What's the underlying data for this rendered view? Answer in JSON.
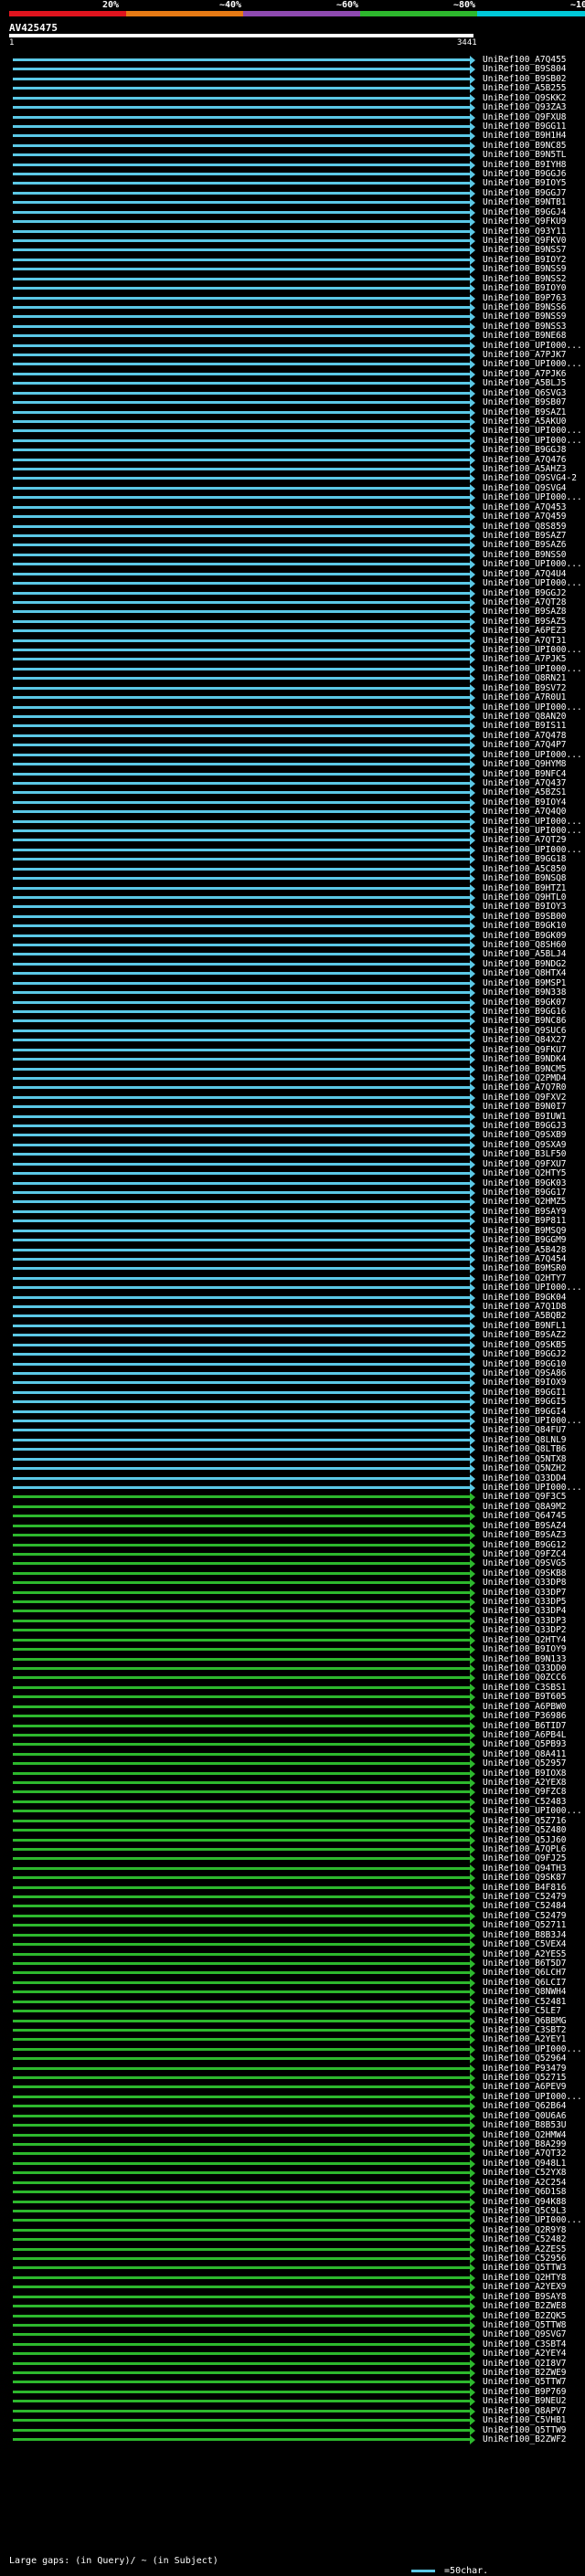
{
  "scale_labels": [
    "20%",
    "~40%",
    "~60%",
    "~80%",
    "~100%"
  ],
  "scale_colors": [
    "#e0141e",
    "#e67a14",
    "#8e4ab0",
    "#2db82d",
    "#00c8d8"
  ],
  "query": {
    "id": "AV425475",
    "start": "1",
    "end": "3441"
  },
  "footer": {
    "large_gaps": "Large gaps:",
    "in_query": "(in Query)/",
    "in_subject": "~ (in Subject)",
    "scale": "=50char."
  },
  "hits": [
    {
      "label": "UniRef100_A7Q455",
      "color": "#5bc8e6"
    },
    {
      "label": "UniRef100_B9S804",
      "color": "#5bc8e6"
    },
    {
      "label": "UniRef100_B9SB02",
      "color": "#5bc8e6"
    },
    {
      "label": "UniRef100_A5B255",
      "color": "#5bc8e6"
    },
    {
      "label": "UniRef100_Q9SKK2",
      "color": "#5bc8e6"
    },
    {
      "label": "UniRef100_Q93ZA3",
      "color": "#5bc8e6"
    },
    {
      "label": "UniRef100_Q9FXU8",
      "color": "#5bc8e6"
    },
    {
      "label": "UniRef100_B9GG11",
      "color": "#5bc8e6"
    },
    {
      "label": "UniRef100_B9H1H4",
      "color": "#5bc8e6"
    },
    {
      "label": "UniRef100_B9NC85",
      "color": "#5bc8e6"
    },
    {
      "label": "UniRef100_B9N5TL",
      "color": "#5bc8e6"
    },
    {
      "label": "UniRef100_B9IYH8",
      "color": "#5bc8e6"
    },
    {
      "label": "UniRef100_B9GGJ6",
      "color": "#5bc8e6"
    },
    {
      "label": "UniRef100_B9IOY5",
      "color": "#5bc8e6"
    },
    {
      "label": "UniRef100_B9GGJ7",
      "color": "#5bc8e6"
    },
    {
      "label": "UniRef100_B9NTB1",
      "color": "#5bc8e6"
    },
    {
      "label": "UniRef100_B9GGJ4",
      "color": "#5bc8e6"
    },
    {
      "label": "UniRef100_Q9FKU9",
      "color": "#5bc8e6"
    },
    {
      "label": "UniRef100_Q93Y11",
      "color": "#5bc8e6"
    },
    {
      "label": "UniRef100_Q9FKV0",
      "color": "#5bc8e6"
    },
    {
      "label": "UniRef100_B9NSS7",
      "color": "#5bc8e6"
    },
    {
      "label": "UniRef100_B9IOY2",
      "color": "#5bc8e6"
    },
    {
      "label": "UniRef100_B9NSS9",
      "color": "#5bc8e6"
    },
    {
      "label": "UniRef100_B9NSS2",
      "color": "#5bc8e6"
    },
    {
      "label": "UniRef100_B9IOY0",
      "color": "#5bc8e6"
    },
    {
      "label": "UniRef100_B9P763",
      "color": "#5bc8e6"
    },
    {
      "label": "UniRef100_B9NSS6",
      "color": "#5bc8e6"
    },
    {
      "label": "UniRef100_B9NSS9",
      "color": "#5bc8e6"
    },
    {
      "label": "UniRef100_B9NSS3",
      "color": "#5bc8e6"
    },
    {
      "label": "UniRef100_B9NE68",
      "color": "#5bc8e6"
    },
    {
      "label": "UniRef100_UPI000...",
      "color": "#5bc8e6"
    },
    {
      "label": "UniRef100_A7PJK7",
      "color": "#5bc8e6"
    },
    {
      "label": "UniRef100_UPI000...",
      "color": "#5bc8e6"
    },
    {
      "label": "UniRef100_A7PJK6",
      "color": "#5bc8e6"
    },
    {
      "label": "UniRef100_A5BLJ5",
      "color": "#5bc8e6"
    },
    {
      "label": "UniRef100_Q6SVG3",
      "color": "#5bc8e6"
    },
    {
      "label": "UniRef100_B9SB07",
      "color": "#5bc8e6"
    },
    {
      "label": "UniRef100_B9SAZ1",
      "color": "#5bc8e6"
    },
    {
      "label": "UniRef100_A5AKU0",
      "color": "#5bc8e6"
    },
    {
      "label": "UniRef100_UPI000...",
      "color": "#5bc8e6"
    },
    {
      "label": "UniRef100_UPI000...",
      "color": "#5bc8e6"
    },
    {
      "label": "UniRef100_B9GGJ8",
      "color": "#5bc8e6"
    },
    {
      "label": "UniRef100_A7Q476",
      "color": "#5bc8e6"
    },
    {
      "label": "UniRef100_A5AHZ3",
      "color": "#5bc8e6"
    },
    {
      "label": "UniRef100_Q9SVG4-2",
      "color": "#5bc8e6"
    },
    {
      "label": "UniRef100_Q9SVG4",
      "color": "#5bc8e6"
    },
    {
      "label": "UniRef100_UPI000...",
      "color": "#5bc8e6"
    },
    {
      "label": "UniRef100_A7Q453",
      "color": "#5bc8e6"
    },
    {
      "label": "UniRef100_A7Q459",
      "color": "#5bc8e6"
    },
    {
      "label": "UniRef100_Q8S859",
      "color": "#5bc8e6"
    },
    {
      "label": "UniRef100_B9SAZ7",
      "color": "#5bc8e6"
    },
    {
      "label": "UniRef100_B9SAZ6",
      "color": "#5bc8e6"
    },
    {
      "label": "UniRef100_B9NSS0",
      "color": "#5bc8e6"
    },
    {
      "label": "UniRef100_UPI000...",
      "color": "#5bc8e6"
    },
    {
      "label": "UniRef100_A7Q4U4",
      "color": "#5bc8e6"
    },
    {
      "label": "UniRef100_UPI000...",
      "color": "#5bc8e6"
    },
    {
      "label": "UniRef100_B9GGJ2",
      "color": "#5bc8e6"
    },
    {
      "label": "UniRef100_A7QT28",
      "color": "#5bc8e6"
    },
    {
      "label": "UniRef100_B9SAZ8",
      "color": "#5bc8e6"
    },
    {
      "label": "UniRef100_B9SAZ5",
      "color": "#5bc8e6"
    },
    {
      "label": "UniRef100_A6PEZ3",
      "color": "#5bc8e6"
    },
    {
      "label": "UniRef100_A7QT31",
      "color": "#5bc8e6"
    },
    {
      "label": "UniRef100_UPI000...",
      "color": "#5bc8e6"
    },
    {
      "label": "UniRef100_A7PJK5",
      "color": "#5bc8e6"
    },
    {
      "label": "UniRef100_UPI000...",
      "color": "#5bc8e6"
    },
    {
      "label": "UniRef100_Q8RN21",
      "color": "#5bc8e6"
    },
    {
      "label": "UniRef100_B9SV72",
      "color": "#5bc8e6"
    },
    {
      "label": "UniRef100_A7R0U1",
      "color": "#5bc8e6"
    },
    {
      "label": "UniRef100_UPI000...",
      "color": "#5bc8e6"
    },
    {
      "label": "UniRef100_Q8AN20",
      "color": "#5bc8e6"
    },
    {
      "label": "UniRef100_B9IS11",
      "color": "#5bc8e6"
    },
    {
      "label": "UniRef100_A7Q478",
      "color": "#5bc8e6"
    },
    {
      "label": "UniRef100_A7Q4P7",
      "color": "#5bc8e6"
    },
    {
      "label": "UniRef100_UPI000...",
      "color": "#5bc8e6"
    },
    {
      "label": "UniRef100_Q9HYM8",
      "color": "#5bc8e6"
    },
    {
      "label": "UniRef100_B9NFC4",
      "color": "#5bc8e6"
    },
    {
      "label": "UniRef100_A7Q437",
      "color": "#5bc8e6"
    },
    {
      "label": "UniRef100_A5BZS1",
      "color": "#5bc8e6"
    },
    {
      "label": "UniRef100_B9IOY4",
      "color": "#5bc8e6"
    },
    {
      "label": "UniRef100_A7Q4Q0",
      "color": "#5bc8e6"
    },
    {
      "label": "UniRef100_UPI000...",
      "color": "#5bc8e6"
    },
    {
      "label": "UniRef100_UPI000...",
      "color": "#5bc8e6"
    },
    {
      "label": "UniRef100_A7QT29",
      "color": "#5bc8e6"
    },
    {
      "label": "UniRef100_UPI000...",
      "color": "#5bc8e6"
    },
    {
      "label": "UniRef100_B9GG18",
      "color": "#5bc8e6"
    },
    {
      "label": "UniRef100_A5C850",
      "color": "#5bc8e6"
    },
    {
      "label": "UniRef100_B9NSQ8",
      "color": "#5bc8e6"
    },
    {
      "label": "UniRef100_B9HTZ1",
      "color": "#5bc8e6"
    },
    {
      "label": "UniRef100_Q9HTL0",
      "color": "#5bc8e6"
    },
    {
      "label": "UniRef100_B9IOY3",
      "color": "#5bc8e6"
    },
    {
      "label": "UniRef100_B9SB00",
      "color": "#5bc8e6"
    },
    {
      "label": "UniRef100_B9GK10",
      "color": "#5bc8e6"
    },
    {
      "label": "UniRef100_B9GK09",
      "color": "#5bc8e6"
    },
    {
      "label": "UniRef100_Q8SH60",
      "color": "#5bc8e6"
    },
    {
      "label": "UniRef100_A5BLJ4",
      "color": "#5bc8e6"
    },
    {
      "label": "UniRef100_B9NDG2",
      "color": "#5bc8e6"
    },
    {
      "label": "UniRef100_Q8HTX4",
      "color": "#5bc8e6"
    },
    {
      "label": "UniRef100_B9MSP1",
      "color": "#5bc8e6"
    },
    {
      "label": "UniRef100_B9N338",
      "color": "#5bc8e6"
    },
    {
      "label": "UniRef100_B9GK07",
      "color": "#5bc8e6"
    },
    {
      "label": "UniRef100_B9GG16",
      "color": "#5bc8e6"
    },
    {
      "label": "UniRef100_B9NC86",
      "color": "#5bc8e6"
    },
    {
      "label": "UniRef100_Q9SUC6",
      "color": "#5bc8e6"
    },
    {
      "label": "UniRef100_Q84X27",
      "color": "#5bc8e6"
    },
    {
      "label": "UniRef100_Q9FKU7",
      "color": "#5bc8e6"
    },
    {
      "label": "UniRef100_B9NDK4",
      "color": "#5bc8e6"
    },
    {
      "label": "UniRef100_B9NCM5",
      "color": "#5bc8e6"
    },
    {
      "label": "UniRef100_Q2PMD4",
      "color": "#5bc8e6"
    },
    {
      "label": "UniRef100_A7Q7R0",
      "color": "#5bc8e6"
    },
    {
      "label": "UniRef100_Q9FXV2",
      "color": "#5bc8e6"
    },
    {
      "label": "UniRef100_B9N0I7",
      "color": "#5bc8e6"
    },
    {
      "label": "UniRef100_B9IUW1",
      "color": "#5bc8e6"
    },
    {
      "label": "UniRef100_B9GGJ3",
      "color": "#5bc8e6"
    },
    {
      "label": "UniRef100_Q9SXB9",
      "color": "#5bc8e6"
    },
    {
      "label": "UniRef100_Q9SXA9",
      "color": "#5bc8e6"
    },
    {
      "label": "UniRef100_B3LF50",
      "color": "#5bc8e6"
    },
    {
      "label": "UniRef100_Q9FXU7",
      "color": "#5bc8e6"
    },
    {
      "label": "UniRef100_Q2HTY5",
      "color": "#5bc8e6"
    },
    {
      "label": "UniRef100_B9GK03",
      "color": "#5bc8e6"
    },
    {
      "label": "UniRef100_B9GG17",
      "color": "#5bc8e6"
    },
    {
      "label": "UniRef100_Q2HMZ5",
      "color": "#5bc8e6"
    },
    {
      "label": "UniRef100_B9SAY9",
      "color": "#5bc8e6"
    },
    {
      "label": "UniRef100_B9P811",
      "color": "#5bc8e6"
    },
    {
      "label": "UniRef100_B9MSQ9",
      "color": "#5bc8e6"
    },
    {
      "label": "UniRef100_B9GGM9",
      "color": "#5bc8e6"
    },
    {
      "label": "UniRef100_A5B428",
      "color": "#5bc8e6"
    },
    {
      "label": "UniRef100_A7Q454",
      "color": "#5bc8e6"
    },
    {
      "label": "UniRef100_B9MSR0",
      "color": "#5bc8e6"
    },
    {
      "label": "UniRef100_Q2HTY7",
      "color": "#5bc8e6"
    },
    {
      "label": "UniRef100_UPI000...",
      "color": "#5bc8e6"
    },
    {
      "label": "UniRef100_B9GK04",
      "color": "#5bc8e6"
    },
    {
      "label": "UniRef100_A7Q1D8",
      "color": "#5bc8e6"
    },
    {
      "label": "UniRef100_A5BQB2",
      "color": "#5bc8e6"
    },
    {
      "label": "UniRef100_B9NFL1",
      "color": "#5bc8e6"
    },
    {
      "label": "UniRef100_B9SAZ2",
      "color": "#5bc8e6"
    },
    {
      "label": "UniRef100_Q9SKB5",
      "color": "#5bc8e6"
    },
    {
      "label": "UniRef100_B9GGJ2",
      "color": "#5bc8e6"
    },
    {
      "label": "UniRef100_B9GG10",
      "color": "#5bc8e6"
    },
    {
      "label": "UniRef100_Q9SA86",
      "color": "#5bc8e6"
    },
    {
      "label": "UniRef100_B9IOX9",
      "color": "#5bc8e6"
    },
    {
      "label": "UniRef100_B9GGI1",
      "color": "#5bc8e6"
    },
    {
      "label": "UniRef100_B9GGI5",
      "color": "#5bc8e6"
    },
    {
      "label": "UniRef100_B9GGI4",
      "color": "#5bc8e6"
    },
    {
      "label": "UniRef100_UPI000...",
      "color": "#5bc8e6"
    },
    {
      "label": "UniRef100_Q84FU7",
      "color": "#5bc8e6"
    },
    {
      "label": "UniRef100_Q8LNL9",
      "color": "#5bc8e6"
    },
    {
      "label": "UniRef100_Q8LTB6",
      "color": "#5bc8e6"
    },
    {
      "label": "UniRef100_Q5NTX8",
      "color": "#5bc8e6"
    },
    {
      "label": "UniRef100_Q5NZH2",
      "color": "#5bc8e6"
    },
    {
      "label": "UniRef100_Q33DD4",
      "color": "#5bc8e6"
    },
    {
      "label": "UniRef100_UPI000...",
      "color": "#5bc8e6"
    },
    {
      "label": "UniRef100_Q9F3C5",
      "color": "#2db82d"
    },
    {
      "label": "UniRef100_Q8A9M2",
      "color": "#2db82d"
    },
    {
      "label": "UniRef100_Q64745",
      "color": "#2db82d"
    },
    {
      "label": "UniRef100_B9SAZ4",
      "color": "#2db82d"
    },
    {
      "label": "UniRef100_B9SAZ3",
      "color": "#2db82d"
    },
    {
      "label": "UniRef100_B9GG12",
      "color": "#2db82d"
    },
    {
      "label": "UniRef100_Q9FZC4",
      "color": "#2db82d"
    },
    {
      "label": "UniRef100_Q9SVG5",
      "color": "#2db82d"
    },
    {
      "label": "UniRef100_Q9SKB8",
      "color": "#2db82d"
    },
    {
      "label": "UniRef100_Q33DP8",
      "color": "#2db82d"
    },
    {
      "label": "UniRef100_Q33DP7",
      "color": "#2db82d"
    },
    {
      "label": "UniRef100_Q33DP5",
      "color": "#2db82d"
    },
    {
      "label": "UniRef100_Q33DP4",
      "color": "#2db82d"
    },
    {
      "label": "UniRef100_Q33DP3",
      "color": "#2db82d"
    },
    {
      "label": "UniRef100_Q33DP2",
      "color": "#2db82d"
    },
    {
      "label": "UniRef100_Q2HTY4",
      "color": "#2db82d"
    },
    {
      "label": "UniRef100_B9IOY9",
      "color": "#2db82d"
    },
    {
      "label": "UniRef100_B9N133",
      "color": "#2db82d"
    },
    {
      "label": "UniRef100_Q33DD0",
      "color": "#2db82d"
    },
    {
      "label": "UniRef100_Q0ZCC6",
      "color": "#2db82d"
    },
    {
      "label": "UniRef100_C3SBS1",
      "color": "#2db82d"
    },
    {
      "label": "UniRef100_B9T605",
      "color": "#2db82d"
    },
    {
      "label": "UniRef100_A6PBW0",
      "color": "#2db82d"
    },
    {
      "label": "UniRef100_P36986",
      "color": "#2db82d"
    },
    {
      "label": "UniRef100_B6TID7",
      "color": "#2db82d"
    },
    {
      "label": "UniRef100_A6PB4L",
      "color": "#2db82d"
    },
    {
      "label": "UniRef100_Q5PB93",
      "color": "#2db82d"
    },
    {
      "label": "UniRef100_Q8A411",
      "color": "#2db82d"
    },
    {
      "label": "UniRef100_Q52957",
      "color": "#2db82d"
    },
    {
      "label": "UniRef100_B9IOX8",
      "color": "#2db82d"
    },
    {
      "label": "UniRef100_A2YEX8",
      "color": "#2db82d"
    },
    {
      "label": "UniRef100_Q9FZC8",
      "color": "#2db82d"
    },
    {
      "label": "UniRef100_C52483",
      "color": "#2db82d"
    },
    {
      "label": "UniRef100_UPI000...",
      "color": "#2db82d"
    },
    {
      "label": "UniRef100_Q5Z716",
      "color": "#2db82d"
    },
    {
      "label": "UniRef100_Q5Z480",
      "color": "#2db82d"
    },
    {
      "label": "UniRef100_Q5JJ60",
      "color": "#2db82d"
    },
    {
      "label": "UniRef100_A7QPL6",
      "color": "#2db82d"
    },
    {
      "label": "UniRef100_Q9FJ25",
      "color": "#2db82d"
    },
    {
      "label": "UniRef100_Q94TH3",
      "color": "#2db82d"
    },
    {
      "label": "UniRef100_Q9SK87",
      "color": "#2db82d"
    },
    {
      "label": "UniRef100_B4F816",
      "color": "#2db82d"
    },
    {
      "label": "UniRef100_C52479",
      "color": "#2db82d"
    },
    {
      "label": "UniRef100_C52484",
      "color": "#2db82d"
    },
    {
      "label": "UniRef100_C52479",
      "color": "#2db82d"
    },
    {
      "label": "UniRef100_Q52711",
      "color": "#2db82d"
    },
    {
      "label": "UniRef100_B8B3J4",
      "color": "#2db82d"
    },
    {
      "label": "UniRef100_C5VEX4",
      "color": "#2db82d"
    },
    {
      "label": "UniRef100_A2YES5",
      "color": "#2db82d"
    },
    {
      "label": "UniRef100_B6T5D7",
      "color": "#2db82d"
    },
    {
      "label": "UniRef100_Q6LCH7",
      "color": "#2db82d"
    },
    {
      "label": "UniRef100_Q6LCI7",
      "color": "#2db82d"
    },
    {
      "label": "UniRef100_Q8NWH4",
      "color": "#2db82d"
    },
    {
      "label": "UniRef100_C52481",
      "color": "#2db82d"
    },
    {
      "label": "UniRef100_C5LE7",
      "color": "#2db82d"
    },
    {
      "label": "UniRef100_Q6BBMG",
      "color": "#2db82d"
    },
    {
      "label": "UniRef100_C3SBT2",
      "color": "#2db82d"
    },
    {
      "label": "UniRef100_A2YEY1",
      "color": "#2db82d"
    },
    {
      "label": "UniRef100_UPI000...",
      "color": "#2db82d"
    },
    {
      "label": "UniRef100_Q52964",
      "color": "#2db82d"
    },
    {
      "label": "UniRef100_P93479",
      "color": "#2db82d"
    },
    {
      "label": "UniRef100_Q52715",
      "color": "#2db82d"
    },
    {
      "label": "UniRef100_A6PEV9",
      "color": "#2db82d"
    },
    {
      "label": "UniRef100_UPI000...",
      "color": "#2db82d"
    },
    {
      "label": "UniRef100_Q62B64",
      "color": "#2db82d"
    },
    {
      "label": "UniRef100_Q0U6A6",
      "color": "#2db82d"
    },
    {
      "label": "UniRef100_B8B53U",
      "color": "#2db82d"
    },
    {
      "label": "UniRef100_Q2HMW4",
      "color": "#2db82d"
    },
    {
      "label": "UniRef100_B8A299",
      "color": "#2db82d"
    },
    {
      "label": "UniRef100_A7QT32",
      "color": "#2db82d"
    },
    {
      "label": "UniRef100_Q948L1",
      "color": "#2db82d"
    },
    {
      "label": "UniRef100_C52YX8",
      "color": "#2db82d"
    },
    {
      "label": "UniRef100_A2C254",
      "color": "#2db82d"
    },
    {
      "label": "UniRef100_Q6D1S8",
      "color": "#2db82d"
    },
    {
      "label": "UniRef100_Q94K88",
      "color": "#2db82d"
    },
    {
      "label": "UniRef100_Q5C9L3",
      "color": "#2db82d"
    },
    {
      "label": "UniRef100_UPI000...",
      "color": "#2db82d"
    },
    {
      "label": "UniRef100_Q2R9Y8",
      "color": "#2db82d"
    },
    {
      "label": "UniRef100_C52482",
      "color": "#2db82d"
    },
    {
      "label": "UniRef100_A2ZES5",
      "color": "#2db82d"
    },
    {
      "label": "UniRef100_C52956",
      "color": "#2db82d"
    },
    {
      "label": "UniRef100_Q5TTW3",
      "color": "#2db82d"
    },
    {
      "label": "UniRef100_Q2HTY8",
      "color": "#2db82d"
    },
    {
      "label": "UniRef100_A2YEX9",
      "color": "#2db82d"
    },
    {
      "label": "UniRef100_B9SAY8",
      "color": "#2db82d"
    },
    {
      "label": "UniRef100_B2ZWE8",
      "color": "#2db82d"
    },
    {
      "label": "UniRef100_B2ZQK5",
      "color": "#2db82d"
    },
    {
      "label": "UniRef100_Q5TTW8",
      "color": "#2db82d"
    },
    {
      "label": "UniRef100_Q9SVG7",
      "color": "#2db82d"
    },
    {
      "label": "UniRef100_C3SBT4",
      "color": "#2db82d"
    },
    {
      "label": "UniRef100_A2YEY4",
      "color": "#2db82d"
    },
    {
      "label": "UniRef100_Q2I8V7",
      "color": "#2db82d"
    },
    {
      "label": "UniRef100_B2ZWE9",
      "color": "#2db82d"
    },
    {
      "label": "UniRef100_Q5TTW7",
      "color": "#2db82d"
    },
    {
      "label": "UniRef100_B9P769",
      "color": "#2db82d"
    },
    {
      "label": "UniRef100_B9NEU2",
      "color": "#2db82d"
    },
    {
      "label": "UniRef100_Q8APV7",
      "color": "#2db82d"
    },
    {
      "label": "UniRef100_C5VHB1",
      "color": "#2db82d"
    },
    {
      "label": "UniRef100_Q5TTW9",
      "color": "#2db82d"
    },
    {
      "label": "UniRef100_B2ZWF2",
      "color": "#2db82d"
    }
  ]
}
